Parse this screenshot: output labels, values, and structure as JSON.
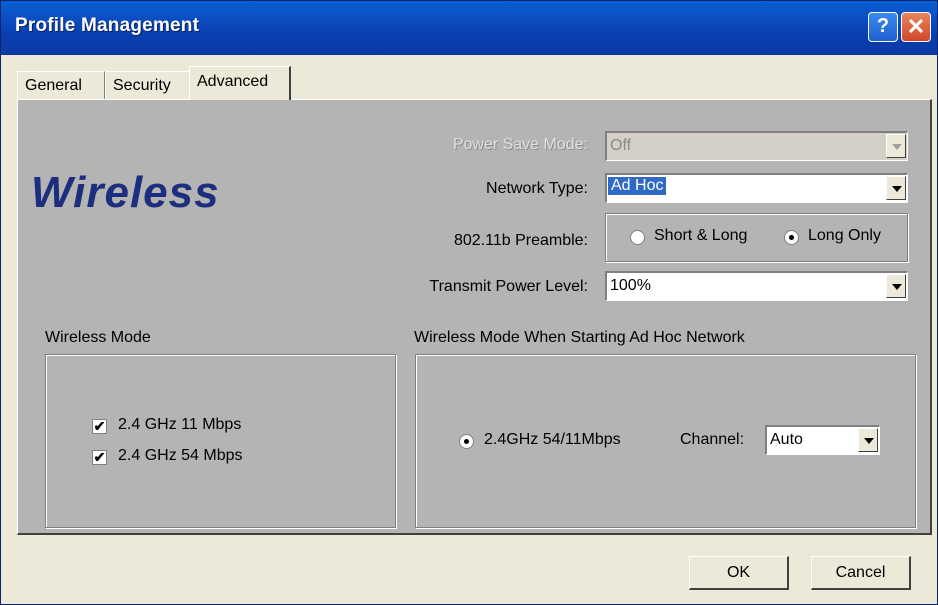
{
  "window": {
    "title": "Profile Management",
    "help_glyph": "?",
    "close_glyph": "✕"
  },
  "tabs": [
    {
      "label": "General"
    },
    {
      "label": "Security"
    },
    {
      "label": "Advanced"
    }
  ],
  "active_tab": "Advanced",
  "logo_text": "Wireless",
  "power_save": {
    "label": "Power Save Mode:",
    "value": "Off",
    "enabled": false
  },
  "network_type": {
    "label": "Network Type:",
    "value": "Ad Hoc"
  },
  "preamble": {
    "label": "802.11b Preamble:",
    "options": [
      {
        "label": "Short & Long",
        "selected": false
      },
      {
        "label": "Long Only",
        "selected": true
      }
    ]
  },
  "transmit_power": {
    "label": "Transmit Power Level:",
    "value": "100%"
  },
  "wireless_mode": {
    "title": "Wireless Mode",
    "options": [
      {
        "label": "2.4 GHz 11 Mbps",
        "checked": true
      },
      {
        "label": "2.4 GHz 54 Mbps",
        "checked": true
      }
    ],
    "check_glyph": "✔"
  },
  "adhoc_mode": {
    "title": "Wireless Mode When Starting Ad Hoc Network",
    "option": {
      "label": "2.4GHz 54/11Mbps",
      "selected": true
    },
    "channel_label": "Channel:",
    "channel_value": "Auto"
  },
  "buttons": {
    "ok": "OK",
    "cancel": "Cancel"
  }
}
